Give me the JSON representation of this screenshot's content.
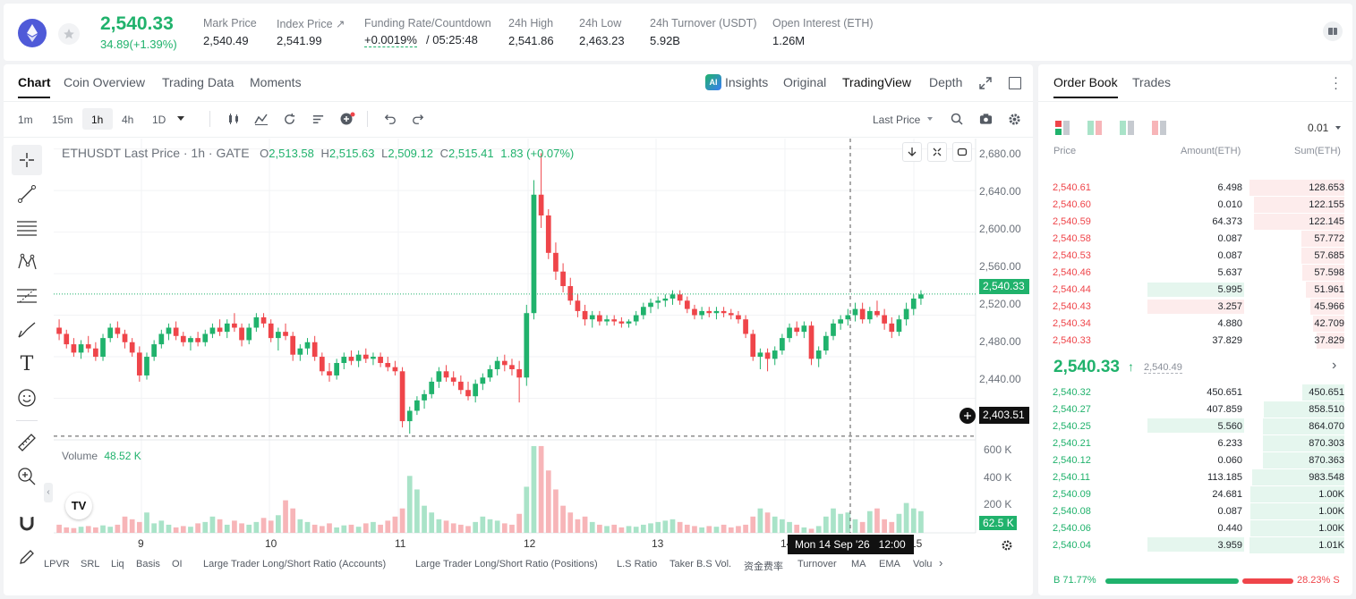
{
  "ticker": {
    "last_price": "2,540.33",
    "change": "34.89(+1.39%)",
    "stats": [
      {
        "label": "Mark Price",
        "value": "2,540.49"
      },
      {
        "label": "Index Price ↗",
        "value": "2,541.99"
      },
      {
        "label": "Funding Rate/Countdown",
        "value_rate": "+0.0019%",
        "value_count": "/ 05:25:48"
      },
      {
        "label": "24h High",
        "value": "2,541.86"
      },
      {
        "label": "24h Low",
        "value": "2,463.23"
      },
      {
        "label": "24h Turnover (USDT)",
        "value": "5.92B"
      },
      {
        "label": "Open Interest (ETH)",
        "value": "1.26M"
      }
    ]
  },
  "chart_tabs": [
    "Chart",
    "Coin Overview",
    "Trading Data",
    "Moments"
  ],
  "view_tabs": {
    "insights": "Insights",
    "original": "Original",
    "tradingview": "TradingView",
    "depth": "Depth"
  },
  "intervals": [
    "1m",
    "15m",
    "1h",
    "4h",
    "1D"
  ],
  "price_type": "Last Price",
  "legend": {
    "symbol": "ETHUSDT Last Price · 1h · GATE",
    "o_label": "O",
    "o": "2,513.58",
    "h_label": "H",
    "h": "2,515.63",
    "l_label": "L",
    "l": "2,509.12",
    "c_label": "C",
    "c": "2,515.41",
    "chg": "1.83 (+0.07%)"
  },
  "volume": {
    "label": "Volume",
    "value": "48.52 K"
  },
  "price_axis": [
    "2,680.00",
    "2,640.00",
    "2,600.00",
    "2,560.00",
    "2,520.00",
    "2,480.00",
    "2,440.00"
  ],
  "volume_axis": [
    "600 K",
    "400 K",
    "200 K"
  ],
  "current_price_tag": "2,540.33",
  "crosshair_price": "2,403.51",
  "volume_tag": "62.5 K",
  "x_axis": [
    "9",
    "10",
    "11",
    "12",
    "13",
    "14",
    "15"
  ],
  "crosshair_time": "Mon 14 Sep '26   12:00",
  "indicators": [
    "LPVR",
    "SRL",
    "Liq",
    "Basis",
    "OI",
    "Large Trader Long/Short Ratio (Accounts)",
    "Large Trader Long/Short Ratio (Positions)",
    "L.S Ratio",
    "Taker B.S Vol.",
    "资金费率",
    "Turnover",
    "MA",
    "EMA",
    "Volu"
  ],
  "chart_data": {
    "type": "candlestick",
    "y_range": [
      2400,
      2690
    ],
    "volume_range": [
      0,
      600000
    ],
    "candles": [
      [
        2508,
        2516,
        2496,
        2502
      ],
      [
        2502,
        2506,
        2488,
        2492
      ],
      [
        2492,
        2498,
        2480,
        2484
      ],
      [
        2484,
        2496,
        2478,
        2492
      ],
      [
        2492,
        2500,
        2484,
        2488
      ],
      [
        2488,
        2494,
        2476,
        2480
      ],
      [
        2480,
        2502,
        2476,
        2498
      ],
      [
        2498,
        2512,
        2494,
        2508
      ],
      [
        2508,
        2514,
        2498,
        2502
      ],
      [
        2502,
        2506,
        2488,
        2494
      ],
      [
        2494,
        2498,
        2480,
        2484
      ],
      [
        2484,
        2490,
        2456,
        2462
      ],
      [
        2462,
        2484,
        2458,
        2480
      ],
      [
        2480,
        2496,
        2476,
        2492
      ],
      [
        2492,
        2506,
        2488,
        2502
      ],
      [
        2502,
        2512,
        2496,
        2508
      ],
      [
        2508,
        2514,
        2496,
        2500
      ],
      [
        2500,
        2504,
        2490,
        2494
      ],
      [
        2494,
        2500,
        2486,
        2498
      ],
      [
        2498,
        2504,
        2490,
        2494
      ],
      [
        2494,
        2506,
        2490,
        2502
      ],
      [
        2502,
        2512,
        2498,
        2508
      ],
      [
        2508,
        2516,
        2500,
        2504
      ],
      [
        2504,
        2516,
        2498,
        2512
      ],
      [
        2512,
        2522,
        2504,
        2508
      ],
      [
        2508,
        2512,
        2490,
        2496
      ],
      [
        2496,
        2512,
        2492,
        2508
      ],
      [
        2508,
        2522,
        2504,
        2518
      ],
      [
        2518,
        2522,
        2508,
        2512
      ],
      [
        2512,
        2516,
        2494,
        2498
      ],
      [
        2498,
        2508,
        2486,
        2504
      ],
      [
        2504,
        2512,
        2496,
        2500
      ],
      [
        2500,
        2504,
        2476,
        2482
      ],
      [
        2482,
        2492,
        2476,
        2488
      ],
      [
        2488,
        2498,
        2482,
        2494
      ],
      [
        2494,
        2500,
        2476,
        2480
      ],
      [
        2480,
        2484,
        2462,
        2466
      ],
      [
        2466,
        2474,
        2456,
        2462
      ],
      [
        2462,
        2478,
        2458,
        2474
      ],
      [
        2474,
        2484,
        2468,
        2480
      ],
      [
        2480,
        2486,
        2472,
        2476
      ],
      [
        2476,
        2486,
        2470,
        2482
      ],
      [
        2482,
        2488,
        2474,
        2478
      ],
      [
        2478,
        2484,
        2472,
        2480
      ],
      [
        2480,
        2484,
        2470,
        2474
      ],
      [
        2474,
        2480,
        2466,
        2470
      ],
      [
        2470,
        2476,
        2462,
        2466
      ],
      [
        2466,
        2470,
        2412,
        2418
      ],
      [
        2418,
        2432,
        2406,
        2428
      ],
      [
        2428,
        2442,
        2424,
        2438
      ],
      [
        2438,
        2448,
        2430,
        2444
      ],
      [
        2444,
        2460,
        2440,
        2456
      ],
      [
        2456,
        2470,
        2450,
        2466
      ],
      [
        2466,
        2472,
        2456,
        2460
      ],
      [
        2460,
        2466,
        2452,
        2456
      ],
      [
        2456,
        2462,
        2444,
        2448
      ],
      [
        2448,
        2456,
        2438,
        2442
      ],
      [
        2442,
        2458,
        2436,
        2454
      ],
      [
        2454,
        2464,
        2448,
        2460
      ],
      [
        2460,
        2472,
        2456,
        2468
      ],
      [
        2468,
        2480,
        2462,
        2476
      ],
      [
        2476,
        2482,
        2466,
        2472
      ],
      [
        2472,
        2478,
        2462,
        2468
      ],
      [
        2468,
        2476,
        2436,
        2460
      ],
      [
        2460,
        2530,
        2452,
        2522
      ],
      [
        2522,
        2650,
        2516,
        2636
      ],
      [
        2636,
        2676,
        2604,
        2616
      ],
      [
        2616,
        2622,
        2574,
        2580
      ],
      [
        2580,
        2590,
        2554,
        2562
      ],
      [
        2562,
        2570,
        2542,
        2548
      ],
      [
        2548,
        2556,
        2530,
        2534
      ],
      [
        2534,
        2540,
        2518,
        2524
      ],
      [
        2524,
        2530,
        2510,
        2516
      ],
      [
        2516,
        2524,
        2508,
        2520
      ],
      [
        2520,
        2524,
        2510,
        2514
      ],
      [
        2514,
        2520,
        2510,
        2516
      ],
      [
        2516,
        2520,
        2510,
        2514
      ],
      [
        2514,
        2518,
        2508,
        2512
      ],
      [
        2512,
        2516,
        2508,
        2514
      ],
      [
        2514,
        2524,
        2510,
        2520
      ],
      [
        2520,
        2532,
        2516,
        2528
      ],
      [
        2528,
        2536,
        2522,
        2532
      ],
      [
        2532,
        2538,
        2526,
        2534
      ],
      [
        2534,
        2540,
        2528,
        2536
      ],
      [
        2536,
        2544,
        2530,
        2540
      ],
      [
        2540,
        2544,
        2530,
        2534
      ],
      [
        2534,
        2538,
        2522,
        2526
      ],
      [
        2526,
        2530,
        2516,
        2520
      ],
      [
        2520,
        2528,
        2516,
        2524
      ],
      [
        2524,
        2528,
        2518,
        2522
      ],
      [
        2522,
        2528,
        2516,
        2524
      ],
      [
        2524,
        2528,
        2518,
        2522
      ],
      [
        2522,
        2526,
        2516,
        2520
      ],
      [
        2520,
        2524,
        2512,
        2516
      ],
      [
        2516,
        2520,
        2498,
        2502
      ],
      [
        2502,
        2506,
        2476,
        2480
      ],
      [
        2480,
        2488,
        2468,
        2484
      ],
      [
        2484,
        2488,
        2466,
        2478
      ],
      [
        2478,
        2490,
        2472,
        2486
      ],
      [
        2486,
        2502,
        2482,
        2498
      ],
      [
        2498,
        2512,
        2494,
        2508
      ],
      [
        2508,
        2514,
        2500,
        2504
      ],
      [
        2504,
        2514,
        2498,
        2510
      ],
      [
        2510,
        2514,
        2472,
        2478
      ],
      [
        2478,
        2490,
        2470,
        2486
      ],
      [
        2486,
        2504,
        2482,
        2500
      ],
      [
        2500,
        2516,
        2496,
        2512
      ],
      [
        2512,
        2520,
        2506,
        2516
      ],
      [
        2516,
        2526,
        2510,
        2520
      ],
      [
        2520,
        2532,
        2514,
        2526
      ],
      [
        2526,
        2532,
        2512,
        2516
      ],
      [
        2516,
        2528,
        2512,
        2524
      ],
      [
        2524,
        2534,
        2518,
        2520
      ],
      [
        2520,
        2526,
        2506,
        2512
      ],
      [
        2512,
        2518,
        2498,
        2504
      ],
      [
        2504,
        2520,
        2500,
        2516
      ],
      [
        2516,
        2532,
        2510,
        2526
      ],
      [
        2526,
        2540,
        2520,
        2536
      ],
      [
        2536,
        2544,
        2530,
        2540
      ]
    ],
    "volumes": [
      60,
      40,
      35,
      45,
      50,
      40,
      55,
      45,
      60,
      120,
      100,
      80,
      150,
      70,
      90,
      60,
      40,
      50,
      45,
      70,
      80,
      120,
      100,
      60,
      90,
      70,
      60,
      80,
      110,
      90,
      130,
      240,
      180,
      100,
      80,
      60,
      50,
      70,
      40,
      55,
      60,
      45,
      70,
      80,
      60,
      90,
      120,
      180,
      420,
      320,
      200,
      150,
      100,
      90,
      70,
      60,
      50,
      80,
      120,
      100,
      90,
      70,
      60,
      140,
      340,
      640,
      640,
      460,
      320,
      200,
      150,
      100,
      120,
      80,
      60,
      50,
      60,
      40,
      50,
      45,
      60,
      70,
      80,
      90,
      100,
      80,
      60,
      50,
      40,
      50,
      45,
      60,
      40,
      50,
      60,
      120,
      180,
      150,
      120,
      100,
      80,
      60,
      40,
      30,
      50,
      120,
      180,
      140,
      150,
      100,
      80,
      160,
      180,
      100,
      80,
      140,
      220,
      180,
      160,
      120,
      90
    ]
  },
  "order_book": {
    "tabs": [
      "Order Book",
      "Trades"
    ],
    "precision": "0.01",
    "headers": [
      "Price",
      "Amount(ETH)",
      "Sum(ETH)"
    ],
    "asks": [
      [
        "2,540.61",
        "6.498",
        "128.653"
      ],
      [
        "2,540.60",
        "0.010",
        "122.155"
      ],
      [
        "2,540.59",
        "64.373",
        "122.145"
      ],
      [
        "2,540.58",
        "0.087",
        "57.772"
      ],
      [
        "2,540.53",
        "0.087",
        "57.685"
      ],
      [
        "2,540.46",
        "5.637",
        "57.598"
      ],
      [
        "2,540.44",
        "5.995",
        "51.961"
      ],
      [
        "2,540.43",
        "3.257",
        "45.966"
      ],
      [
        "2,540.34",
        "4.880",
        "42.709"
      ],
      [
        "2,540.33",
        "37.829",
        "37.829"
      ]
    ],
    "ask_depth": [
      0.128653,
      0.122155,
      0.122145,
      0.057772,
      0.057685,
      0.057598,
      0.051961,
      0.045966,
      0.042709,
      0.037829
    ],
    "mid_price": "2,540.33",
    "mid_mark": "2,540.49",
    "bids": [
      [
        "2,540.32",
        "450.651",
        "450.651"
      ],
      [
        "2,540.27",
        "407.859",
        "858.510"
      ],
      [
        "2,540.25",
        "5.560",
        "864.070"
      ],
      [
        "2,540.21",
        "6.233",
        "870.303"
      ],
      [
        "2,540.12",
        "0.060",
        "870.363"
      ],
      [
        "2,540.11",
        "113.185",
        "983.548"
      ],
      [
        "2,540.09",
        "24.681",
        "1.00K"
      ],
      [
        "2,540.08",
        "0.087",
        "1.00K"
      ],
      [
        "2,540.06",
        "0.440",
        "1.00K"
      ],
      [
        "2,540.04",
        "3.959",
        "1.01K"
      ]
    ],
    "bid_depth": [
      0.450651,
      0.85851,
      0.86407,
      0.870303,
      0.870363,
      0.983548,
      1.0,
      1.0,
      1.0,
      1.01
    ],
    "buy_pct": "B 71.77%",
    "sell_pct": "28.23% S",
    "buy_ratio": 0.7177
  },
  "colors": {
    "up": "#20b26c",
    "down": "#ef454a",
    "up_vol": "#a9e3c8",
    "down_vol": "#f7b5b8"
  }
}
